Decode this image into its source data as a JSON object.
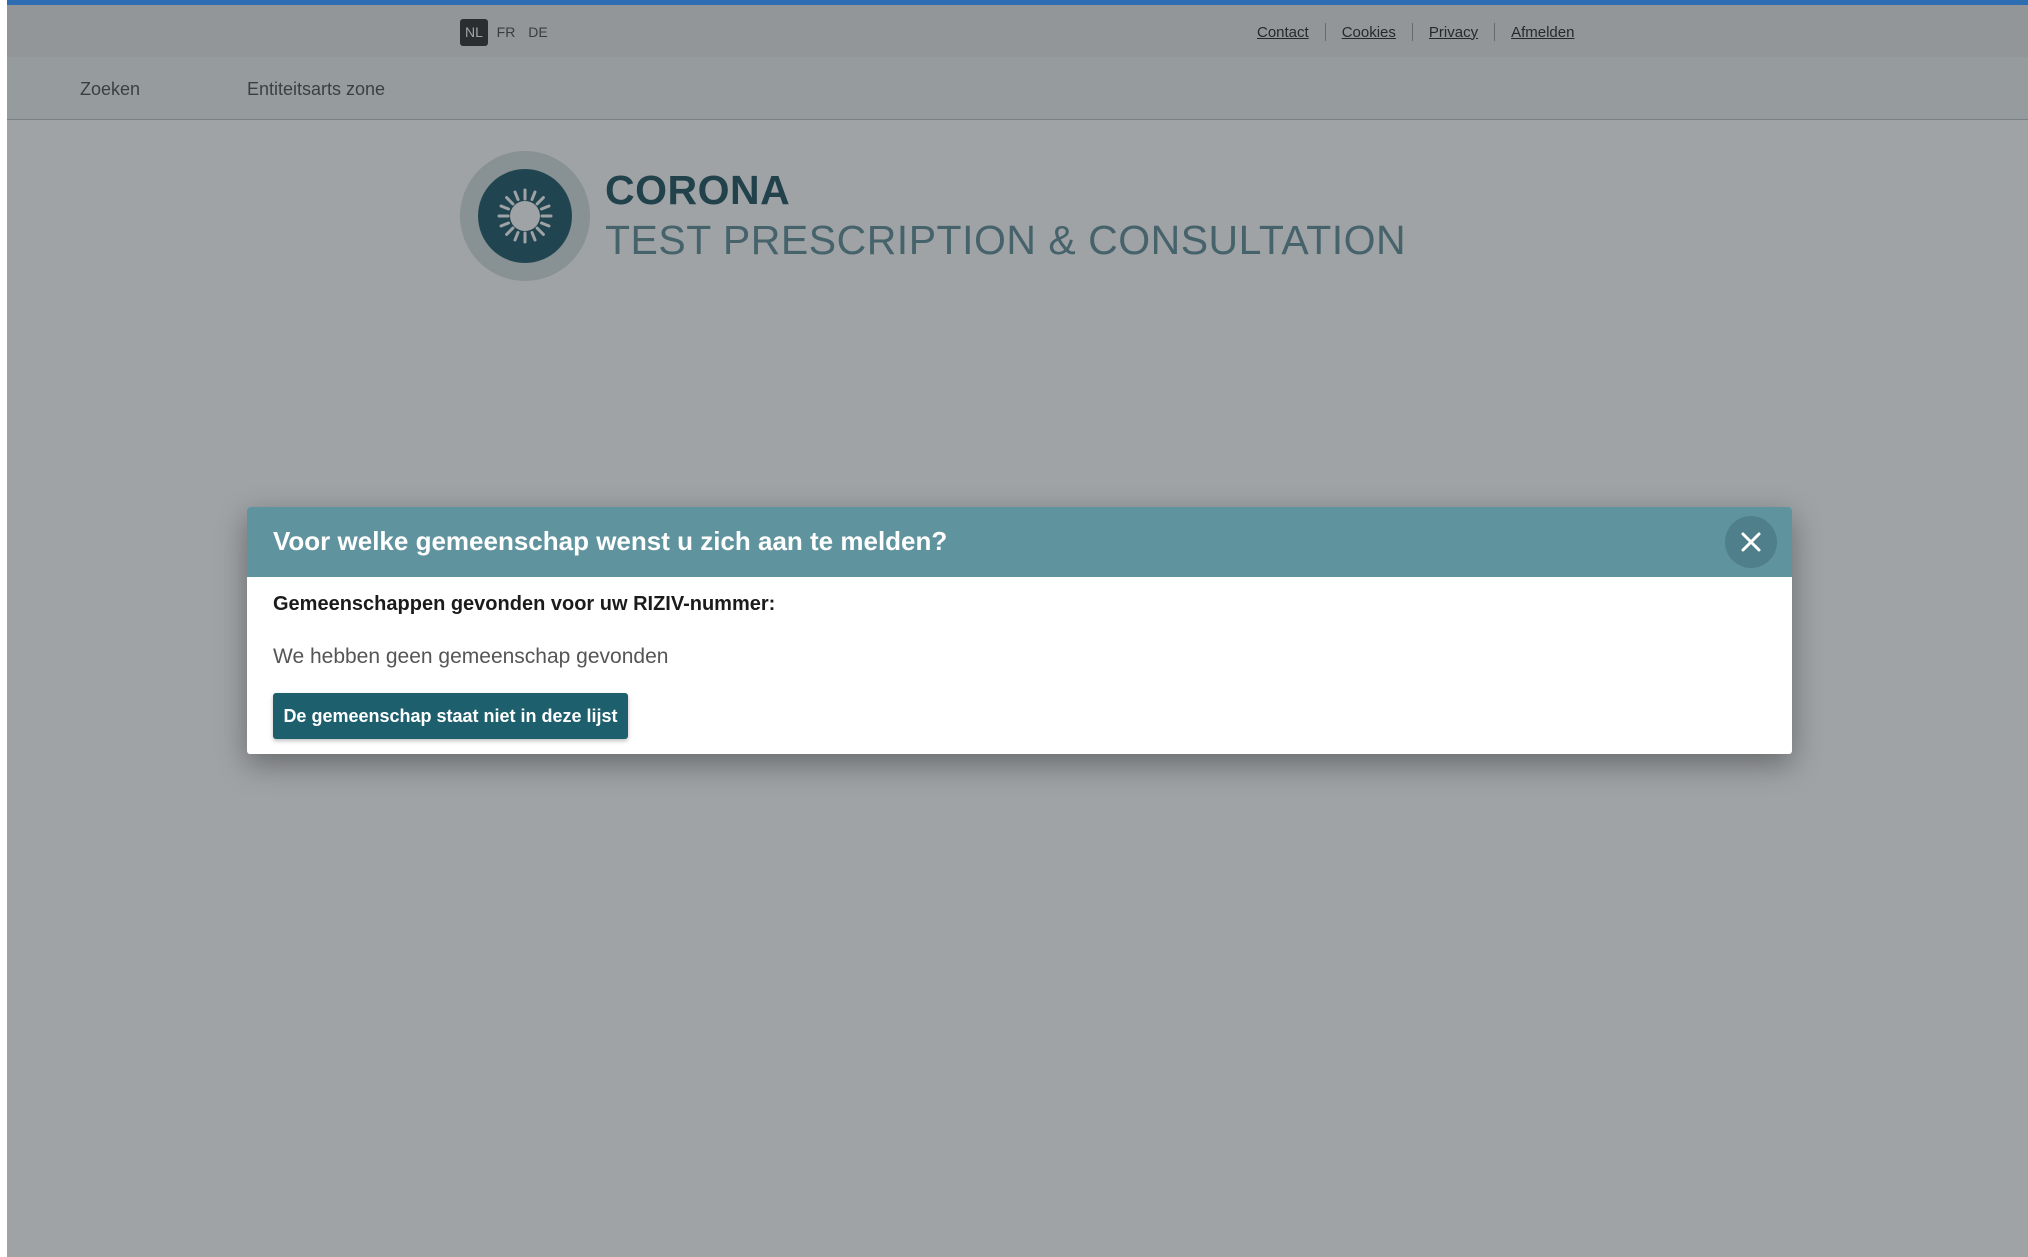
{
  "languages": [
    {
      "code": "NL",
      "active": true
    },
    {
      "code": "FR",
      "active": false
    },
    {
      "code": "DE",
      "active": false
    }
  ],
  "utility_links": [
    "Contact",
    "Cookies",
    "Privacy",
    "Afmelden"
  ],
  "nav": {
    "search": "Zoeken",
    "entity_zone": "Entiteitsarts zone"
  },
  "brand": {
    "line1": "CORONA",
    "line2": "TEST PRESCRIPTION & CONSULTATION",
    "icon": "virus-icon"
  },
  "modal": {
    "title": "Voor welke gemeenschap wenst u zich aan te melden?",
    "subtitle": "Gemeenschappen gevonden voor uw RIZIV-nummer:",
    "empty_message": "We hebben geen gemeenschap gevonden",
    "action_label": "De gemeenschap staat niet in deze lijst",
    "close_icon": "close-icon"
  },
  "colors": {
    "modal_header": "#5f939e",
    "action_button": "#1e5f6e",
    "top_stripe": "#2f6db3"
  }
}
